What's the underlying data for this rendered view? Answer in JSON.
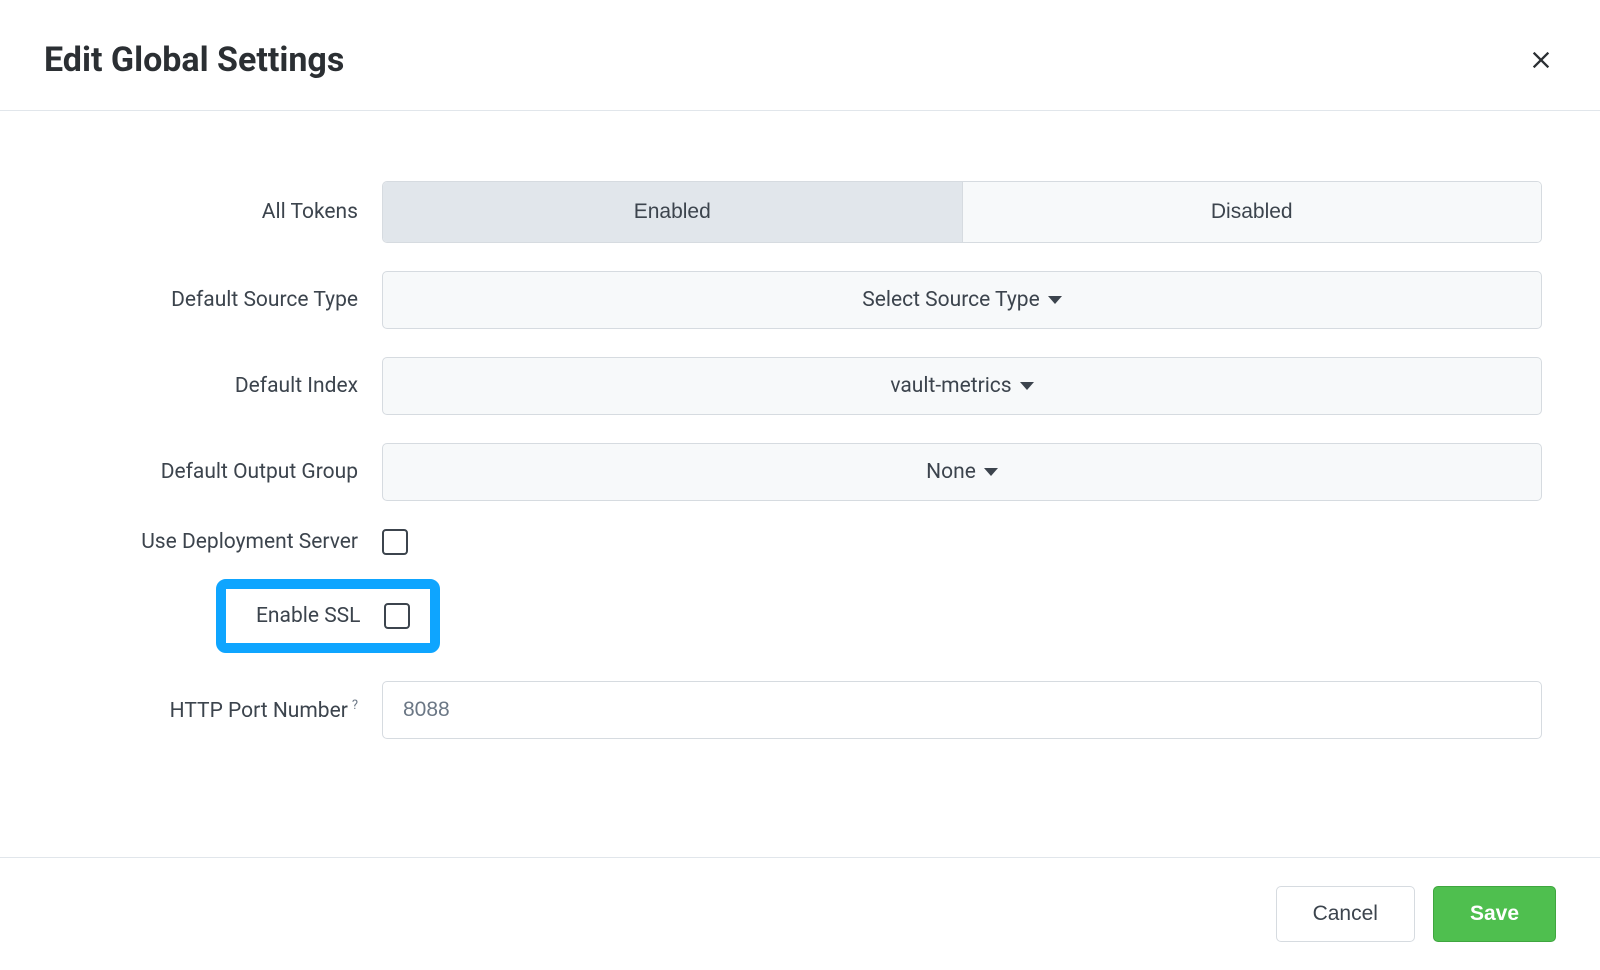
{
  "header": {
    "title": "Edit Global Settings"
  },
  "form": {
    "all_tokens": {
      "label": "All Tokens",
      "option_enabled": "Enabled",
      "option_disabled": "Disabled",
      "selected": "Enabled"
    },
    "default_source_type": {
      "label": "Default Source Type",
      "value": "Select Source Type"
    },
    "default_index": {
      "label": "Default Index",
      "value": "vault-metrics"
    },
    "default_output_group": {
      "label": "Default Output Group",
      "value": "None"
    },
    "use_deployment_server": {
      "label": "Use Deployment Server",
      "checked": false
    },
    "enable_ssl": {
      "label": "Enable SSL",
      "checked": false,
      "highlighted": true
    },
    "http_port": {
      "label": "HTTP Port Number",
      "help": "?",
      "value": "8088"
    }
  },
  "footer": {
    "cancel": "Cancel",
    "save": "Save"
  }
}
